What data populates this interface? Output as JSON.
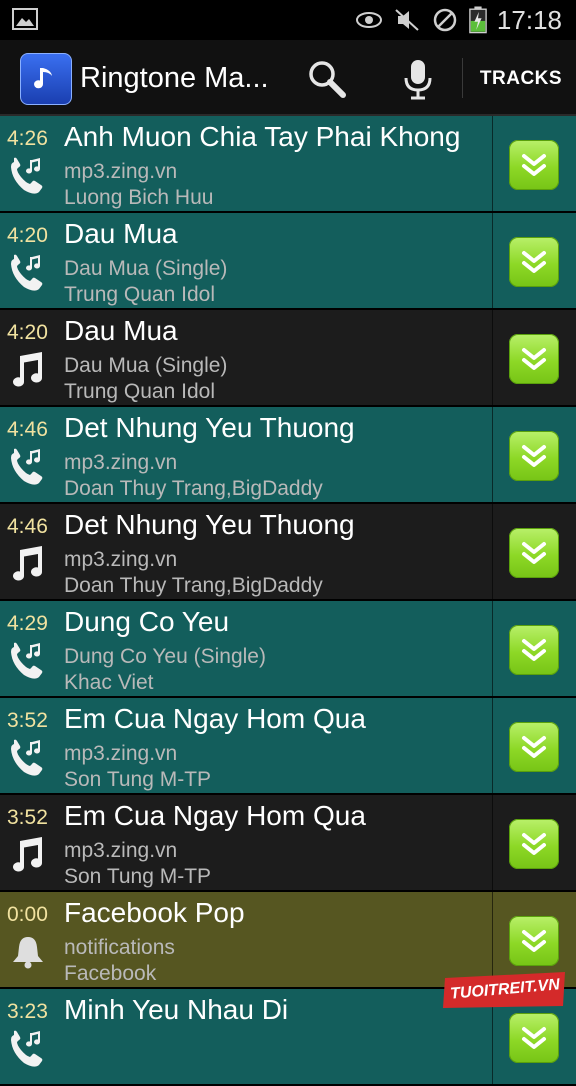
{
  "status_bar": {
    "time": "17:18",
    "icons": [
      "image-icon",
      "eye-icon",
      "mute-icon",
      "no-signal-icon",
      "battery-charging-icon"
    ]
  },
  "action_bar": {
    "title": "Ringtone Ma...",
    "tracks_label": "TRACKS",
    "icons": [
      "app-music-icon",
      "search-icon",
      "microphone-icon"
    ]
  },
  "colors": {
    "teal_row": "#135e5c",
    "dark_row": "#1c1c1c",
    "olive_row": "#565621",
    "duration": "#f1e2a0",
    "download_button": "#8dd826"
  },
  "tracks": [
    {
      "duration": "4:26",
      "title": "Anh Muon Chia Tay Phai Khong",
      "album": "mp3.zing.vn",
      "artist": "Luong Bich Huu",
      "type": "ringtone-icon",
      "bg": "teal"
    },
    {
      "duration": "4:20",
      "title": "Dau Mua",
      "album": "Dau Mua (Single)",
      "artist": "Trung Quan Idol",
      "type": "ringtone-icon",
      "bg": "teal"
    },
    {
      "duration": "4:20",
      "title": "Dau Mua",
      "album": "Dau Mua (Single)",
      "artist": "Trung Quan Idol",
      "type": "music-note-icon",
      "bg": "dark"
    },
    {
      "duration": "4:46",
      "title": "Det Nhung Yeu Thuong",
      "album": "mp3.zing.vn",
      "artist": "Doan Thuy Trang,BigDaddy",
      "type": "ringtone-icon",
      "bg": "teal"
    },
    {
      "duration": "4:46",
      "title": "Det Nhung Yeu Thuong",
      "album": "mp3.zing.vn",
      "artist": "Doan Thuy Trang,BigDaddy",
      "type": "music-note-icon",
      "bg": "dark"
    },
    {
      "duration": "4:29",
      "title": "Dung Co Yeu",
      "album": "Dung Co Yeu (Single)",
      "artist": "Khac Viet",
      "type": "ringtone-icon",
      "bg": "teal"
    },
    {
      "duration": "3:52",
      "title": "Em Cua Ngay Hom Qua",
      "album": "mp3.zing.vn",
      "artist": "Son Tung M-TP",
      "type": "ringtone-icon",
      "bg": "teal"
    },
    {
      "duration": "3:52",
      "title": "Em Cua Ngay Hom Qua",
      "album": "mp3.zing.vn",
      "artist": "Son Tung M-TP",
      "type": "music-note-icon",
      "bg": "dark"
    },
    {
      "duration": "0:00",
      "title": "Facebook Pop",
      "album": "notifications",
      "artist": "Facebook",
      "type": "notification-bell-icon",
      "bg": "olive"
    },
    {
      "duration": "3:23",
      "title": "Minh Yeu Nhau Di",
      "album": "",
      "artist": "",
      "type": "ringtone-icon",
      "bg": "teal"
    }
  ],
  "watermark": "TUOITREIT.VN"
}
